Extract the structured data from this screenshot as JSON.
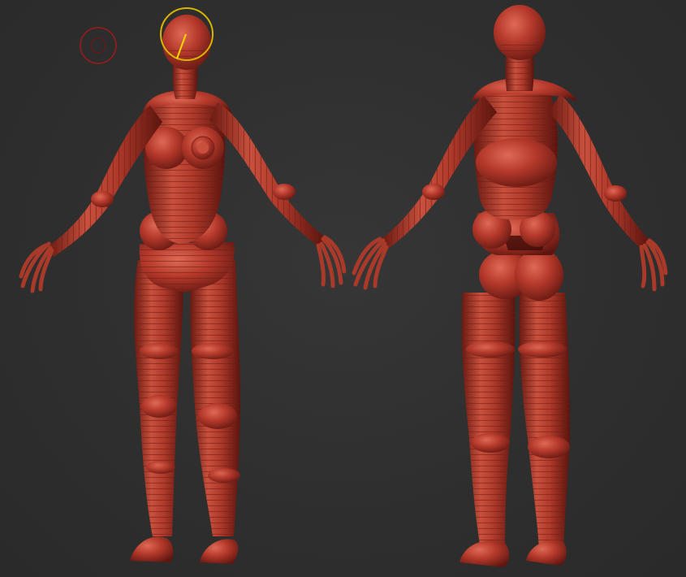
{
  "viewport": {
    "tool": "zsphere-sculpt",
    "colors": {
      "background": "#2f2f2f",
      "clay_base": "#b5392b",
      "clay_dark": "#6a1812",
      "clay_light": "#d9634f",
      "band_line": "#7d2219",
      "brush_cursor": "#9b1c1c",
      "gizmo_ring": "#d8b300",
      "gizmo_line": "#ffd800"
    },
    "models": [
      {
        "view": "front",
        "name": "zsphere-figure-front"
      },
      {
        "view": "back",
        "name": "zsphere-figure-back"
      }
    ]
  }
}
